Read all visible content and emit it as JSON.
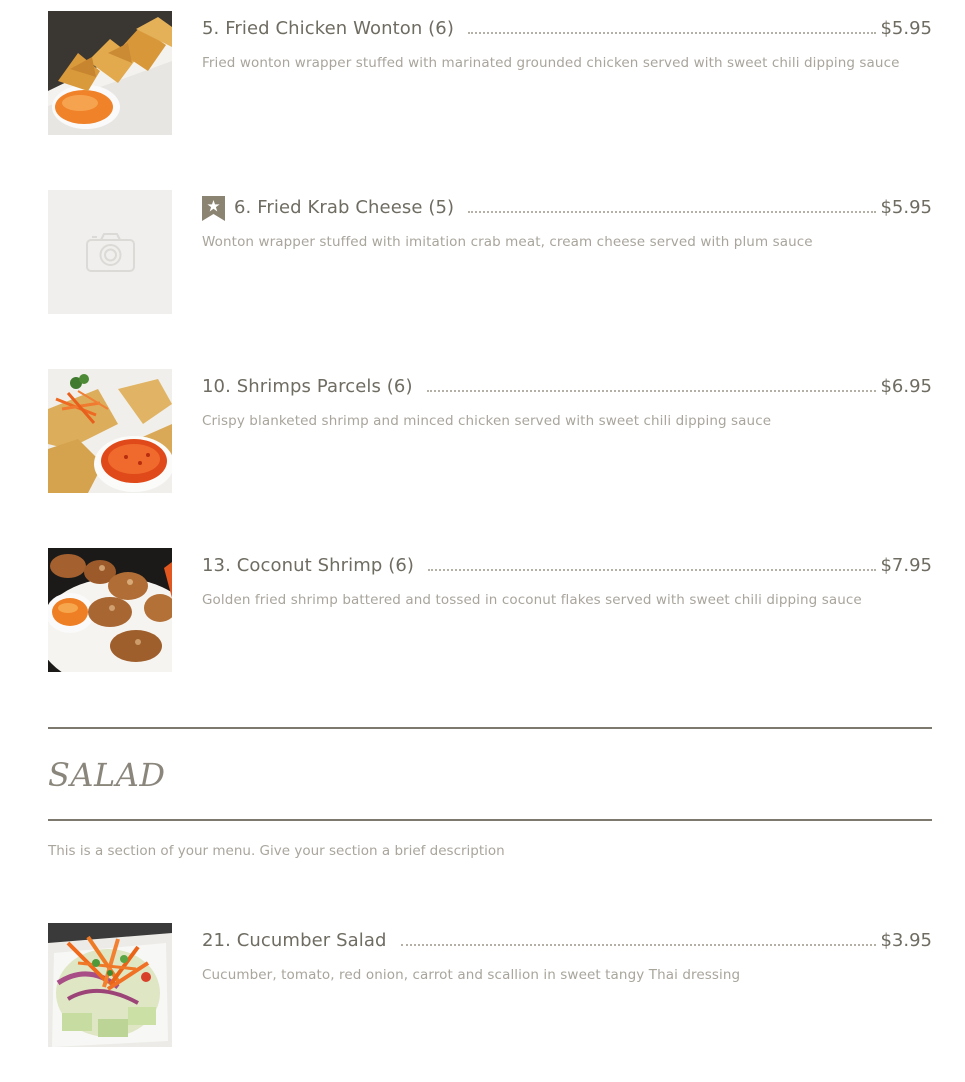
{
  "items": [
    {
      "name": "5. Fried Chicken Wonton (6)",
      "price": "$5.95",
      "description": "Fried wonton wrapper stuffed with marinated grounded chicken served with sweet chili dipping sauce"
    },
    {
      "name": "6. Fried Krab Cheese (5)",
      "price": "$5.95",
      "description": "Wonton wrapper stuffed with imitation crab meat, cream cheese served with plum sauce",
      "badge": "star-bookmark-icon"
    },
    {
      "name": "10. Shrimps Parcels (6)",
      "price": "$6.95",
      "description": "Crispy blanketed shrimp and minced chicken served with sweet chili dipping sauce"
    },
    {
      "name": "13. Coconut Shrimp (6)",
      "price": "$7.95",
      "description": "Golden fried shrimp battered and tossed in coconut flakes served with sweet chili dipping sauce"
    }
  ],
  "section": {
    "title": "SALAD",
    "description": "This is a section of your menu. Give your section a brief description"
  },
  "salad_items": [
    {
      "name": "21. Cucumber Salad",
      "price": "$3.95",
      "description": "Cucumber, tomato, red onion, carrot and scallion in sweet tangy Thai dressing"
    }
  ],
  "colors": {
    "text": "#6f6c62",
    "muted": "#a9a59c",
    "rule": "#7d796f",
    "badge": "#8c8472",
    "placeholder_bg": "#f0efed"
  },
  "placeholder_icon": "camera-icon"
}
